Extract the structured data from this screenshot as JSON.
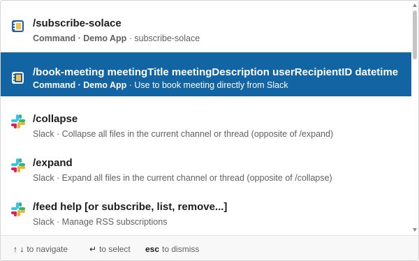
{
  "items": [
    {
      "title": "/subscribe-solace",
      "source": "Command · Demo App",
      "description": " · subscribe-solace",
      "icon": "notebook-icon",
      "selected": false
    },
    {
      "title": "/book-meeting meetingTitle meetingDescription userRecipientID datetime",
      "source": "Command · Demo App",
      "description": " · Use to book meeting directly from Slack",
      "icon": "notebook-icon",
      "selected": true
    },
    {
      "title": "/collapse",
      "source": "Slack",
      "description": " · Collapse all files in the current channel or thread (opposite of /expand)",
      "icon": "slack-icon",
      "selected": false
    },
    {
      "title": "/expand",
      "source": "Slack",
      "description": " · Expand all files in the current channel or thread (opposite of /collapse)",
      "icon": "slack-icon",
      "selected": false
    },
    {
      "title": "/feed help [or subscribe, list, remove...]",
      "source": "Slack",
      "description": " · Manage RSS subscriptions",
      "icon": "slack-icon",
      "selected": false
    }
  ],
  "footer": {
    "navigate_keys": "↑ ↓",
    "navigate_label": "to navigate",
    "select_key": "↵",
    "select_label": "to select",
    "dismiss_key": "esc",
    "dismiss_label": "to dismiss"
  },
  "colors": {
    "selected_bg": "#1264a3",
    "slack_blue": "#36c5f0",
    "slack_green": "#2eb67d",
    "slack_yellow": "#ecb22e",
    "slack_red": "#e01e5a"
  }
}
